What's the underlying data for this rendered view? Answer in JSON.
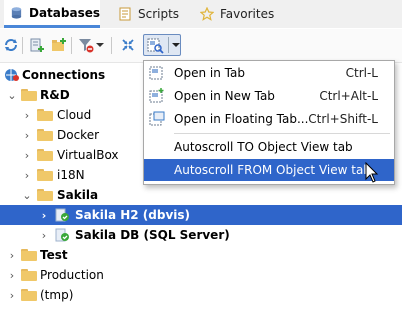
{
  "tabs": [
    {
      "label": "Databases",
      "icon": "database-icon",
      "active": true
    },
    {
      "label": "Scripts",
      "icon": "scripts-icon",
      "active": false
    },
    {
      "label": "Favorites",
      "icon": "star-icon",
      "active": false
    }
  ],
  "toolbar": {
    "buttons": [
      "refresh-icon",
      "new-connection-icon",
      "new-folder-icon",
      "filter-icon",
      "collapse-all-icon",
      "link-with-editor-icon"
    ]
  },
  "tree": [
    {
      "label": "Connections",
      "icon": "connections-icon",
      "expanded": true,
      "bold": true
    },
    {
      "label": "R&D",
      "icon": "folder-icon",
      "expanded": true,
      "bold": true
    },
    {
      "label": "Cloud",
      "icon": "folder-icon",
      "expanded": false,
      "bold": false
    },
    {
      "label": "Docker",
      "icon": "folder-icon",
      "expanded": false,
      "bold": false
    },
    {
      "label": "VirtualBox",
      "icon": "folder-icon",
      "expanded": false,
      "bold": false
    },
    {
      "label": "i18N",
      "icon": "folder-icon",
      "expanded": false,
      "bold": false
    },
    {
      "label": "Sakila",
      "icon": "folder-icon",
      "expanded": true,
      "bold": true
    },
    {
      "label": "Sakila H2 (dbvis)",
      "icon": "database-connected-icon",
      "expanded": false,
      "bold": true,
      "selected": true
    },
    {
      "label": "Sakila DB (SQL Server)",
      "icon": "database-connected-icon",
      "expanded": false,
      "bold": true
    },
    {
      "label": "Test",
      "icon": "folder-icon",
      "expanded": false,
      "bold": true
    },
    {
      "label": "Production",
      "icon": "folder-icon",
      "expanded": false,
      "bold": false
    },
    {
      "label": "(tmp)",
      "icon": "folder-icon",
      "expanded": false,
      "bold": false
    }
  ],
  "menu": {
    "items": [
      {
        "label": "Open in Tab",
        "shortcut": "Ctrl-L",
        "icon": "open-in-tab-icon"
      },
      {
        "label": "Open in New Tab",
        "shortcut": "Ctrl+Alt-L",
        "icon": "open-in-new-tab-icon"
      },
      {
        "label": "Open in Floating Tab...",
        "shortcut": "Ctrl+Shift-L",
        "icon": "open-in-floating-tab-icon"
      },
      {
        "label": "Autoscroll TO Object View tab",
        "shortcut": ""
      },
      {
        "label": "Autoscroll FROM Object View tab",
        "shortcut": "",
        "active": true
      }
    ]
  },
  "colors": {
    "selection": "#2f65ca",
    "tab_underline": "#4a87d8",
    "folder": "#f0c869"
  }
}
